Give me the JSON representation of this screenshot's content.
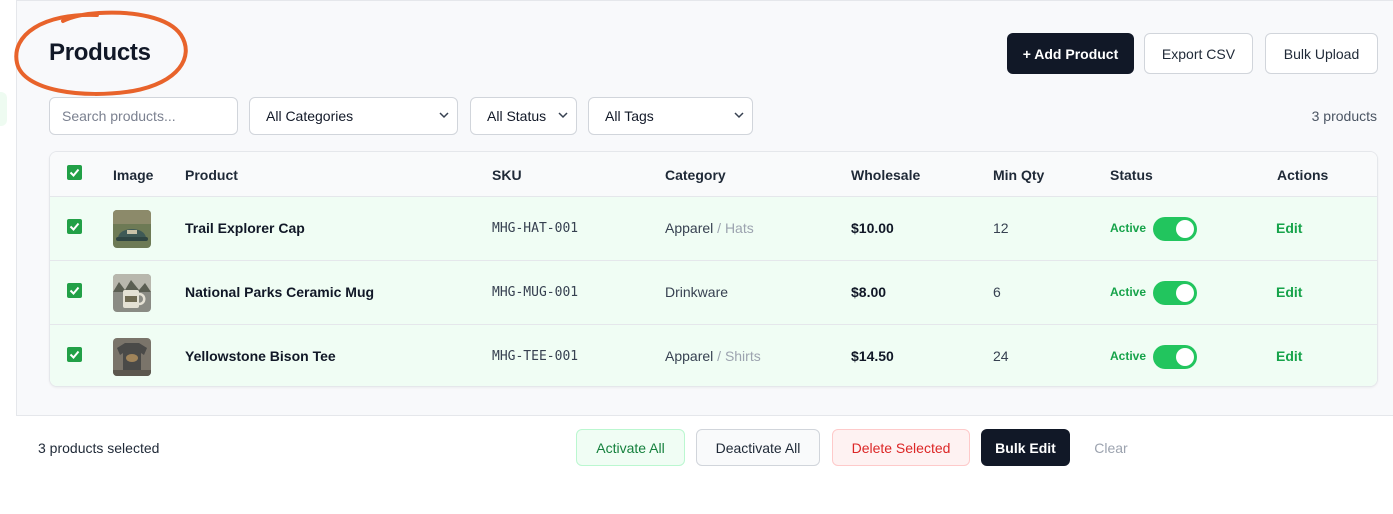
{
  "header": {
    "title": "Products",
    "add_label": "+ Add Product",
    "export_label": "Export CSV",
    "bulk_upload_label": "Bulk Upload"
  },
  "filters": {
    "search_placeholder": "Search products...",
    "category_selected": "All Categories",
    "status_selected": "All Status",
    "tags_selected": "All Tags",
    "count_label": "3 products"
  },
  "table": {
    "columns": [
      "Image",
      "Product",
      "SKU",
      "Category",
      "Wholesale",
      "Min Qty",
      "Status",
      "Actions"
    ],
    "rows": [
      {
        "name": "Trail Explorer Cap",
        "sku": "MHG-HAT-001",
        "category": "Apparel",
        "sep": "/",
        "subcategory": "Hats",
        "wholesale": "$10.00",
        "min_qty": "12",
        "status": "Active",
        "action": "Edit",
        "active": true,
        "selected": true,
        "thumb_color": "#3f5a56"
      },
      {
        "name": "National Parks Ceramic Mug",
        "sku": "MHG-MUG-001",
        "category": "Drinkware",
        "sep": "",
        "subcategory": "",
        "wholesale": "$8.00",
        "min_qty": "6",
        "status": "Active",
        "action": "Edit",
        "active": true,
        "selected": true,
        "thumb_color": "#6f6a52"
      },
      {
        "name": "Yellowstone Bison Tee",
        "sku": "MHG-TEE-001",
        "category": "Apparel",
        "sep": "/",
        "subcategory": "Shirts",
        "wholesale": "$14.50",
        "min_qty": "24",
        "status": "Active",
        "action": "Edit",
        "active": true,
        "selected": true,
        "thumb_color": "#4a4a48"
      }
    ]
  },
  "bulk_bar": {
    "selected_label": "3 products selected",
    "activate_label": "Activate All",
    "deactivate_label": "Deactivate All",
    "delete_label": "Delete Selected",
    "bulk_edit_label": "Bulk Edit",
    "clear_label": "Clear"
  },
  "colors": {
    "accent_green": "#22c55e",
    "dark": "#111827",
    "annotation_orange": "#e8632b"
  },
  "icons": [
    "chevron-down-icon",
    "check-icon"
  ]
}
